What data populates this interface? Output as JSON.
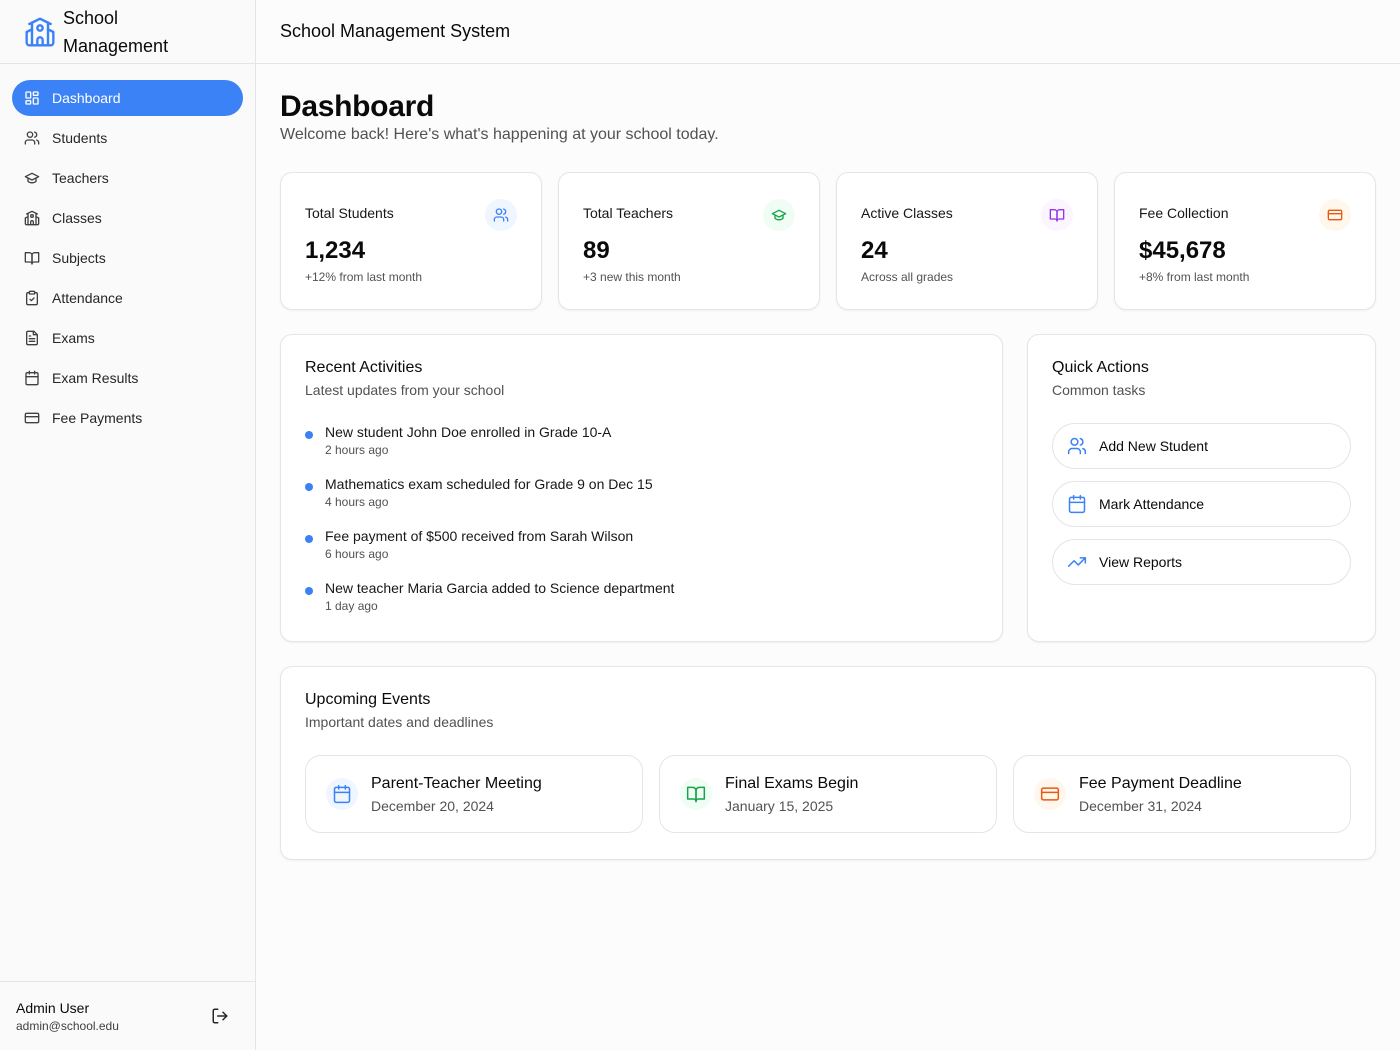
{
  "brand": {
    "name": "School Management",
    "icon": "school-icon"
  },
  "header": {
    "title": "School Management System"
  },
  "sidebar": {
    "items": [
      {
        "label": "Dashboard",
        "icon": "dashboard-icon",
        "active": true
      },
      {
        "label": "Students",
        "icon": "users-icon"
      },
      {
        "label": "Teachers",
        "icon": "graduation-cap-icon"
      },
      {
        "label": "Classes",
        "icon": "school-icon"
      },
      {
        "label": "Subjects",
        "icon": "book-open-icon"
      },
      {
        "label": "Attendance",
        "icon": "clipboard-check-icon"
      },
      {
        "label": "Exams",
        "icon": "file-text-icon"
      },
      {
        "label": "Exam Results",
        "icon": "calendar-icon"
      },
      {
        "label": "Fee Payments",
        "icon": "credit-card-icon"
      }
    ]
  },
  "user": {
    "name": "Admin User",
    "email": "admin@school.edu",
    "logout_icon": "logout-icon"
  },
  "page": {
    "title": "Dashboard",
    "subtitle": "Welcome back! Here's what's happening at your school today."
  },
  "stats": [
    {
      "label": "Total Students",
      "value": "1,234",
      "note": "+12% from last month",
      "icon": "users-icon",
      "color": "#3b82f6",
      "bg": "#eff6ff"
    },
    {
      "label": "Total Teachers",
      "value": "89",
      "note": "+3 new this month",
      "icon": "graduation-cap-icon",
      "color": "#16a34a",
      "bg": "#f0fdf4"
    },
    {
      "label": "Active Classes",
      "value": "24",
      "note": "Across all grades",
      "icon": "book-open-icon",
      "color": "#9333ea",
      "bg": "#faf5ff"
    },
    {
      "label": "Fee Collection",
      "value": "$45,678",
      "note": "+8% from last month",
      "icon": "credit-card-icon",
      "color": "#ea580c",
      "bg": "#fff7ed"
    }
  ],
  "activities": {
    "title": "Recent Activities",
    "subtitle": "Latest updates from your school",
    "items": [
      {
        "text": "New student John Doe enrolled in Grade 10-A",
        "time": "2 hours ago"
      },
      {
        "text": "Mathematics exam scheduled for Grade 9 on Dec 15",
        "time": "4 hours ago"
      },
      {
        "text": "Fee payment of $500 received from Sarah Wilson",
        "time": "6 hours ago"
      },
      {
        "text": "New teacher Maria Garcia added to Science department",
        "time": "1 day ago"
      }
    ]
  },
  "quick_actions": {
    "title": "Quick Actions",
    "subtitle": "Common tasks",
    "items": [
      {
        "label": "Add New Student",
        "icon": "users-icon"
      },
      {
        "label": "Mark Attendance",
        "icon": "calendar-icon"
      },
      {
        "label": "View Reports",
        "icon": "trending-up-icon"
      }
    ]
  },
  "events": {
    "title": "Upcoming Events",
    "subtitle": "Important dates and deadlines",
    "items": [
      {
        "title": "Parent-Teacher Meeting",
        "date": "December 20, 2024",
        "icon": "calendar-icon",
        "color": "#3b82f6",
        "bg": "#eff6ff"
      },
      {
        "title": "Final Exams Begin",
        "date": "January 15, 2025",
        "icon": "book-open-icon",
        "color": "#16a34a",
        "bg": "#f0fdf4"
      },
      {
        "title": "Fee Payment Deadline",
        "date": "December 31, 2024",
        "icon": "credit-card-icon",
        "color": "#ea580c",
        "bg": "#fff7ed"
      }
    ]
  }
}
